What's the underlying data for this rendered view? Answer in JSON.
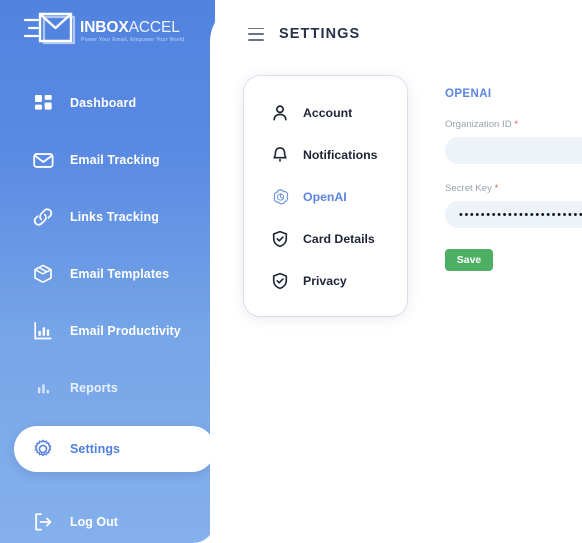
{
  "brand": {
    "name_bold": "INBOX",
    "name_light": "ACCEL",
    "tagline": "Power Your Email, Empower Your World",
    "logo_icon": "envelope-speed-icon"
  },
  "sidebar": {
    "background_top_color": "#5183df",
    "background_bottom_color": "#84b0ec",
    "active_item_bg": "#ffffff",
    "active_item_text_color": "#4f7fdd",
    "items": [
      {
        "label": "Dashboard",
        "icon": "grid-icon",
        "active": false
      },
      {
        "label": "Email Tracking",
        "icon": "envelope-icon",
        "active": false
      },
      {
        "label": "Links Tracking",
        "icon": "link-icon",
        "active": false
      },
      {
        "label": "Email Templates",
        "icon": "box-icon",
        "active": false
      },
      {
        "label": "Email Productivity",
        "icon": "bar-chart-icon",
        "active": false
      },
      {
        "label": "Reports",
        "icon": "bar-chart-small-icon",
        "active": false
      },
      {
        "label": "Settings",
        "icon": "gear-icon",
        "active": true
      }
    ],
    "logout": {
      "label": "Log Out",
      "icon": "logout-icon"
    }
  },
  "header": {
    "menu_icon": "hamburger-icon",
    "title": "SETTINGS"
  },
  "settings_menu": {
    "items": [
      {
        "label": "Account",
        "icon": "user-icon",
        "active": false
      },
      {
        "label": "Notifications",
        "icon": "bell-icon",
        "active": false
      },
      {
        "label": "OpenAI",
        "icon": "openai-icon",
        "active": true
      },
      {
        "label": "Card Details",
        "icon": "shield-check-icon",
        "active": false
      },
      {
        "label": "Privacy",
        "icon": "shield-check-icon",
        "active": false
      }
    ],
    "active_color": "#5b84e0"
  },
  "openai_form": {
    "title": "OPENAI",
    "accent_color": "#5b84e0",
    "required_marker": "*",
    "fields": [
      {
        "label": "Organization ID",
        "required": true,
        "value": "",
        "placeholder": "",
        "masked": false
      },
      {
        "label": "Secret Key",
        "required": true,
        "value": "••••••••••••••••••••••••••••",
        "placeholder": "",
        "masked": true
      }
    ],
    "save_label": "Save",
    "save_color": "#4caf64"
  }
}
